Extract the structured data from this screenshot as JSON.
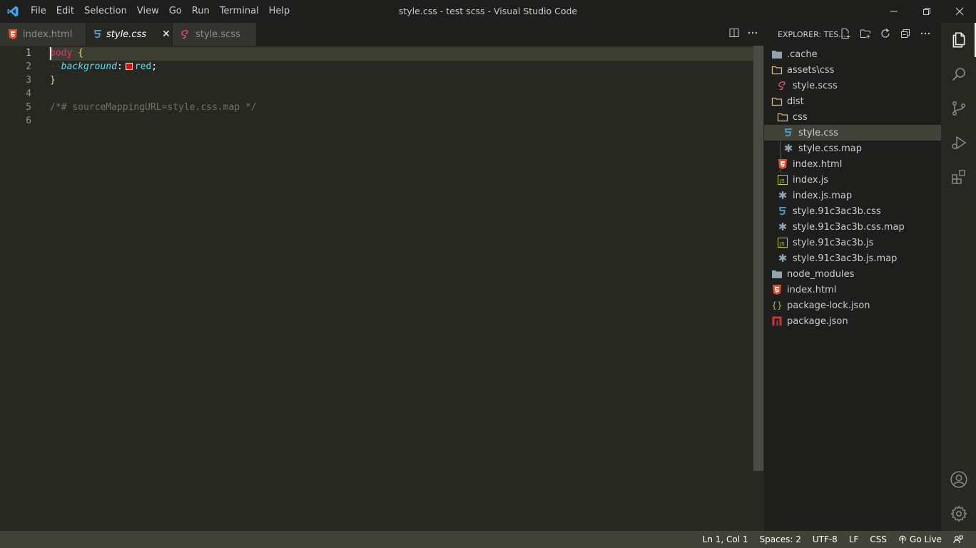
{
  "window": {
    "title": "style.css - test scss - Visual Studio Code",
    "menu": [
      "File",
      "Edit",
      "Selection",
      "View",
      "Go",
      "Run",
      "Terminal",
      "Help"
    ]
  },
  "tabs": [
    {
      "label": "index.html",
      "icon": "html5-icon",
      "active": false
    },
    {
      "label": "style.css",
      "icon": "css3-icon",
      "active": true,
      "close": "✕"
    },
    {
      "label": "style.scss",
      "icon": "sass-icon",
      "active": false
    }
  ],
  "editor": {
    "line_numbers": [
      "1",
      "2",
      "3",
      "4",
      "5",
      "6"
    ],
    "code": {
      "l1_selector": "body",
      "l1_brace": "{",
      "l2_indent": "··",
      "l2_prop": "background",
      "l2_colon": ":",
      "l2_value": "red",
      "l2_semi": ";",
      "l3_brace": "}",
      "l5_comment": "/*# sourceMappingURL=style.css.map */"
    },
    "color_swatch": "#ff0000"
  },
  "explorer": {
    "header": "EXPLORER: TES...",
    "items": [
      {
        "label": ".cache",
        "icon": "folder-icon",
        "indent": 0
      },
      {
        "label": "assets\\css",
        "icon": "folder-icon",
        "indent": 0
      },
      {
        "label": "style.scss",
        "icon": "sass-icon",
        "indent": 1
      },
      {
        "label": "dist",
        "icon": "folder-open-icon",
        "indent": 0
      },
      {
        "label": "css",
        "icon": "folder-open-icon",
        "indent": 1
      },
      {
        "label": "style.css",
        "icon": "css3-icon",
        "indent": 2,
        "selected": true
      },
      {
        "label": "style.css.map",
        "icon": "asterisk-icon",
        "indent": 2
      },
      {
        "label": "index.html",
        "icon": "html5-icon",
        "indent": 1
      },
      {
        "label": "index.js",
        "icon": "js-icon",
        "indent": 1
      },
      {
        "label": "index.js.map",
        "icon": "asterisk-icon",
        "indent": 1
      },
      {
        "label": "style.91c3ac3b.css",
        "icon": "css3-icon",
        "indent": 1
      },
      {
        "label": "style.91c3ac3b.css.map",
        "icon": "asterisk-icon",
        "indent": 1
      },
      {
        "label": "style.91c3ac3b.js",
        "icon": "js-icon",
        "indent": 1
      },
      {
        "label": "style.91c3ac3b.js.map",
        "icon": "asterisk-icon",
        "indent": 1
      },
      {
        "label": "node_modules",
        "icon": "folder-icon",
        "indent": 0
      },
      {
        "label": "index.html",
        "icon": "html5-icon",
        "indent": 0
      },
      {
        "label": "package-lock.json",
        "icon": "json-icon",
        "indent": 0
      },
      {
        "label": "package.json",
        "icon": "npm-icon",
        "indent": 0
      }
    ]
  },
  "statusbar": {
    "position": "Ln 1, Col 1",
    "spaces": "Spaces: 2",
    "encoding": "UTF-8",
    "eol": "LF",
    "language": "CSS",
    "golive": "Go Live"
  },
  "colors": {
    "editor_bg": "#272822",
    "sidebar_bg": "#1e1f1c",
    "statusbar_bg": "#414339",
    "keyword": "#f92672",
    "property": "#66d9ef"
  }
}
